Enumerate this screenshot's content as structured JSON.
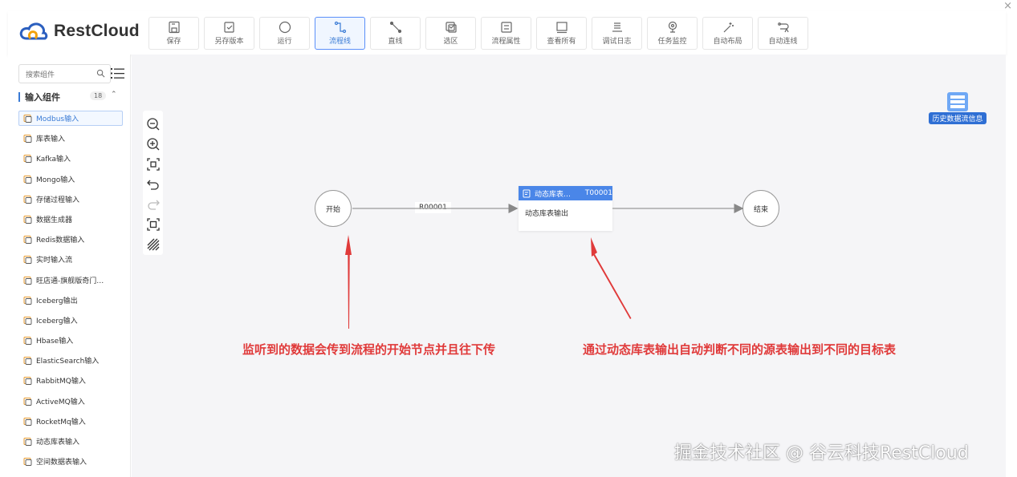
{
  "window": {
    "close_glyph": "×"
  },
  "app": {
    "name": "RestCloud",
    "logo_icon": "cloud-logo-icon",
    "brand_color": "#2b5fbf"
  },
  "toolbar": {
    "items": [
      {
        "label": "保存",
        "icon": "save-icon"
      },
      {
        "label": "另存版本",
        "icon": "save-as-icon"
      },
      {
        "label": "运行",
        "icon": "run-icon"
      },
      {
        "label": "流程线",
        "icon": "flow-line-icon",
        "active": true
      },
      {
        "label": "直线",
        "icon": "straight-line-icon"
      },
      {
        "label": "选区",
        "icon": "select-area-icon"
      },
      {
        "label": "流程属性",
        "icon": "flow-props-icon"
      },
      {
        "label": "查看所有",
        "icon": "view-all-icon"
      },
      {
        "label": "调试日志",
        "icon": "debug-log-icon"
      },
      {
        "label": "任务监控",
        "icon": "task-monitor-icon"
      },
      {
        "label": "自动布局",
        "icon": "auto-layout-icon"
      },
      {
        "label": "自动连线",
        "icon": "auto-connect-icon"
      }
    ]
  },
  "sidebar": {
    "search_placeholder": "搜索组件",
    "group": {
      "title": "输入组件",
      "count": "18",
      "caret": "⌃"
    },
    "components": [
      {
        "label": "Modbus输入",
        "active": true
      },
      {
        "label": "库表输入"
      },
      {
        "label": "Kafka输入"
      },
      {
        "label": "Mongo输入"
      },
      {
        "label": "存储过程输入"
      },
      {
        "label": "数据生成器"
      },
      {
        "label": "Redis数据输入"
      },
      {
        "label": "实时输入流"
      },
      {
        "label": "旺店通-旗舰版奇门…"
      },
      {
        "label": "Iceberg输出"
      },
      {
        "label": "Iceberg输入"
      },
      {
        "label": "Hbase输入"
      },
      {
        "label": "ElasticSearch输入"
      },
      {
        "label": "RabbitMQ输入"
      },
      {
        "label": "ActiveMQ输入"
      },
      {
        "label": "RocketMq输入"
      },
      {
        "label": "动态库表输入"
      },
      {
        "label": "空间数据表输入"
      }
    ]
  },
  "canvas": {
    "start_node": "开始",
    "end_node": "结束",
    "edge_label": "R00001",
    "task_node": {
      "title": "动态库表…",
      "id": "T00001",
      "body": "动态库表输出",
      "header_color": "#4a86e8"
    },
    "history_label": "历史数据流信息",
    "annotation_left": "监听到的数据会传到流程的开始节点并且往下传",
    "annotation_right": "通过动态库表输出自动判断不同的源表输出到不同的目标表",
    "annotation_color": "#e03a3a"
  },
  "watermark": "掘金技术社区 @ 谷云科技RestCloud"
}
